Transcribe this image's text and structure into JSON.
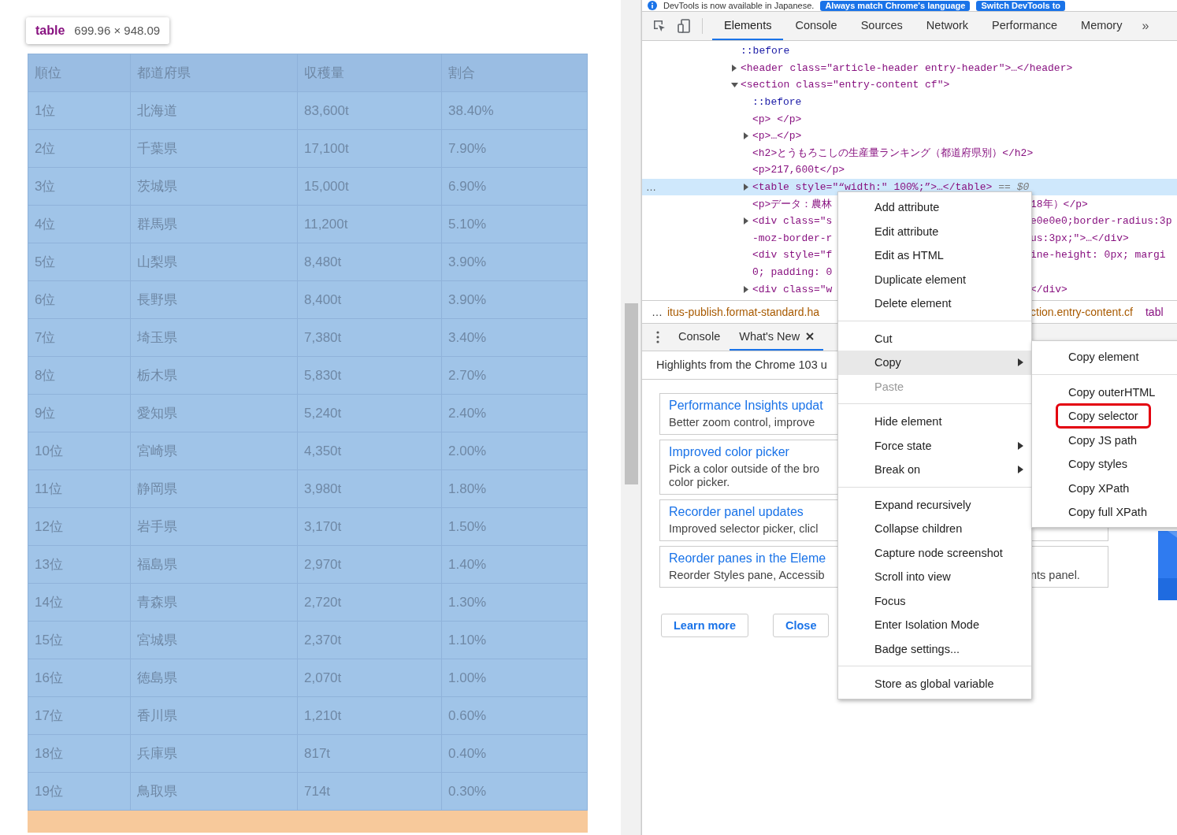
{
  "page": {
    "tooltip": {
      "tag": "table",
      "size": "699.96 × 948.09"
    },
    "table": {
      "columns": [
        "順位",
        "都道府県",
        "収穫量",
        "割合"
      ],
      "rows": [
        [
          "1位",
          "北海道",
          "83,600t",
          "38.40%"
        ],
        [
          "2位",
          "千葉県",
          "17,100t",
          "7.90%"
        ],
        [
          "3位",
          "茨城県",
          "15,000t",
          "6.90%"
        ],
        [
          "4位",
          "群馬県",
          "11,200t",
          "5.10%"
        ],
        [
          "5位",
          "山梨県",
          "8,480t",
          "3.90%"
        ],
        [
          "6位",
          "長野県",
          "8,400t",
          "3.90%"
        ],
        [
          "7位",
          "埼玉県",
          "7,380t",
          "3.40%"
        ],
        [
          "8位",
          "栃木県",
          "5,830t",
          "2.70%"
        ],
        [
          "9位",
          "愛知県",
          "5,240t",
          "2.40%"
        ],
        [
          "10位",
          "宮崎県",
          "4,350t",
          "2.00%"
        ],
        [
          "11位",
          "静岡県",
          "3,980t",
          "1.80%"
        ],
        [
          "12位",
          "岩手県",
          "3,170t",
          "1.50%"
        ],
        [
          "13位",
          "福島県",
          "2,970t",
          "1.40%"
        ],
        [
          "14位",
          "青森県",
          "2,720t",
          "1.30%"
        ],
        [
          "15位",
          "宮城県",
          "2,370t",
          "1.10%"
        ],
        [
          "16位",
          "徳島県",
          "2,070t",
          "1.00%"
        ],
        [
          "17位",
          "香川県",
          "1,210t",
          "0.60%"
        ],
        [
          "18位",
          "兵庫県",
          "817t",
          "0.40%"
        ],
        [
          "19位",
          "鳥取県",
          "714t",
          "0.30%"
        ]
      ]
    }
  },
  "devtools": {
    "infobar": {
      "message": "DevTools is now available in Japanese.",
      "buttons": [
        "Always match Chrome's language",
        "Switch DevTools to"
      ]
    },
    "tabs": [
      {
        "label": "Elements",
        "selected": true
      },
      {
        "label": "Console",
        "selected": false
      },
      {
        "label": "Sources",
        "selected": false
      },
      {
        "label": "Network",
        "selected": false
      },
      {
        "label": "Performance",
        "selected": false
      },
      {
        "label": "Memory",
        "selected": false
      }
    ],
    "overflow": "»",
    "tree": [
      {
        "kind": "pseudo",
        "selected": false,
        "lines": [
          {
            "left": "::before"
          }
        ]
      },
      {
        "kind": "element",
        "expanded": false,
        "selected": false,
        "lines": [
          {
            "left": "<header class=\"article-header entry-header\">…</header>"
          }
        ]
      },
      {
        "kind": "element",
        "expanded": true,
        "selected": false,
        "lines": [
          {
            "left": "<section class=\"entry-content cf\">"
          }
        ],
        "children": [
          {
            "kind": "pseudo",
            "selected": false,
            "lines": [
              {
                "left": "::before"
              }
            ]
          },
          {
            "kind": "element",
            "selected": false,
            "lines": [
              {
                "left": "<p> </p>"
              }
            ]
          },
          {
            "kind": "element",
            "expanded": false,
            "selected": false,
            "lines": [
              {
                "left": "<p>…</p>"
              }
            ]
          },
          {
            "kind": "element",
            "selected": false,
            "lines": [
              {
                "left": "<h2>とうもろこしの生産量ランキング（都道府県別）</h2>"
              }
            ]
          },
          {
            "kind": "element",
            "selected": false,
            "lines": [
              {
                "left": "<p>217,600t</p>"
              }
            ]
          },
          {
            "kind": "element",
            "expanded": false,
            "selected": true,
            "gutter": "…",
            "suffix": "== $0",
            "lines": [
              {
                "left": "<table style=\"“width:\" 100%;”>…</table>"
              }
            ]
          },
          {
            "kind": "element",
            "selected": false,
            "lines": [
              {
                "left": "<p>データ：農林",
                "right": "18年）</p>"
              }
            ]
          },
          {
            "kind": "element",
            "expanded": false,
            "selected": false,
            "lines": [
              {
                "left": "<div class=\"s",
                "right": "e0e0e0;border-radius:3p"
              },
              {
                "left": "-moz-border-r",
                "right": "us:3px;\">…</div>"
              }
            ]
          },
          {
            "kind": "element",
            "selected": false,
            "lines": [
              {
                "left": "<div style=\"f",
                "right": "ine-height: 0px; margi"
              },
              {
                "left": "0; padding: 0"
              }
            ]
          },
          {
            "kind": "element",
            "expanded": false,
            "selected": false,
            "lines": [
              {
                "left": "<div class=\"w",
                "right": "</div>"
              }
            ]
          }
        ]
      }
    ],
    "breadcrumbs": {
      "left": [
        {
          "kind": "more",
          "text": "…"
        },
        {
          "kind": "class",
          "text": "itus-publish.format-standard.ha"
        }
      ],
      "right": [
        {
          "kind": "class",
          "text": "ction.entry-content.cf"
        },
        {
          "kind": "tag",
          "text": "tabl"
        }
      ]
    },
    "drawer": {
      "tabs": [
        {
          "label": "Console",
          "selected": false,
          "closable": false
        },
        {
          "label": "What's New",
          "selected": true,
          "closable": true
        }
      ],
      "highlights": "Highlights from the Chrome 103 u",
      "cards": [
        {
          "title": "Performance Insights updat",
          "desc": [
            "Better zoom control, improve"
          ]
        },
        {
          "title": "Improved color picker",
          "desc": [
            "Pick a color outside of the bro",
            "color picker."
          ]
        },
        {
          "title": "Recorder panel updates",
          "desc": [
            "Improved selector picker, clicl"
          ]
        },
        {
          "title": "Reorder panes in the Eleme",
          "desc": [
            "Reorder Styles pane, Accessib"
          ],
          "desc_right": "nts panel."
        }
      ],
      "buttons": [
        "Learn more",
        "Close"
      ]
    },
    "context_menu": {
      "items": [
        {
          "kind": "item",
          "label": "Add attribute",
          "highlighted": false,
          "disabled": false,
          "submenu": false
        },
        {
          "kind": "item",
          "label": "Edit attribute",
          "highlighted": false,
          "disabled": false,
          "submenu": false
        },
        {
          "kind": "item",
          "label": "Edit as HTML",
          "highlighted": false,
          "disabled": false,
          "submenu": false
        },
        {
          "kind": "item",
          "label": "Duplicate element",
          "highlighted": false,
          "disabled": false,
          "submenu": false
        },
        {
          "kind": "item",
          "label": "Delete element",
          "highlighted": false,
          "disabled": false,
          "submenu": false
        },
        {
          "kind": "separator"
        },
        {
          "kind": "item",
          "label": "Cut",
          "highlighted": false,
          "disabled": false,
          "submenu": false
        },
        {
          "kind": "item",
          "label": "Copy",
          "highlighted": true,
          "disabled": false,
          "submenu": true
        },
        {
          "kind": "item",
          "label": "Paste",
          "highlighted": false,
          "disabled": true,
          "submenu": false
        },
        {
          "kind": "separator"
        },
        {
          "kind": "item",
          "label": "Hide element",
          "highlighted": false,
          "disabled": false,
          "submenu": false
        },
        {
          "kind": "item",
          "label": "Force state",
          "highlighted": false,
          "disabled": false,
          "submenu": true
        },
        {
          "kind": "item",
          "label": "Break on",
          "highlighted": false,
          "disabled": false,
          "submenu": true
        },
        {
          "kind": "separator"
        },
        {
          "kind": "item",
          "label": "Expand recursively",
          "highlighted": false,
          "disabled": false,
          "submenu": false
        },
        {
          "kind": "item",
          "label": "Collapse children",
          "highlighted": false,
          "disabled": false,
          "submenu": false
        },
        {
          "kind": "item",
          "label": "Capture node screenshot",
          "highlighted": false,
          "disabled": false,
          "submenu": false
        },
        {
          "kind": "item",
          "label": "Scroll into view",
          "highlighted": false,
          "disabled": false,
          "submenu": false
        },
        {
          "kind": "item",
          "label": "Focus",
          "highlighted": false,
          "disabled": false,
          "submenu": false
        },
        {
          "kind": "item",
          "label": "Enter Isolation Mode",
          "highlighted": false,
          "disabled": false,
          "submenu": false
        },
        {
          "kind": "item",
          "label": "Badge settings...",
          "highlighted": false,
          "disabled": false,
          "submenu": false
        },
        {
          "kind": "separator"
        },
        {
          "kind": "item",
          "label": "Store as global variable",
          "highlighted": false,
          "disabled": false,
          "submenu": false
        }
      ]
    },
    "submenu": {
      "items": [
        {
          "kind": "item",
          "label": "Copy element",
          "marked": false
        },
        {
          "kind": "separator"
        },
        {
          "kind": "item",
          "label": "Copy outerHTML",
          "marked": false
        },
        {
          "kind": "item",
          "label": "Copy selector",
          "marked": true
        },
        {
          "kind": "item",
          "label": "Copy JS path",
          "marked": false
        },
        {
          "kind": "item",
          "label": "Copy styles",
          "marked": false
        },
        {
          "kind": "item",
          "label": "Copy XPath",
          "marked": false
        },
        {
          "kind": "item",
          "label": "Copy full XPath",
          "marked": false
        }
      ]
    }
  }
}
